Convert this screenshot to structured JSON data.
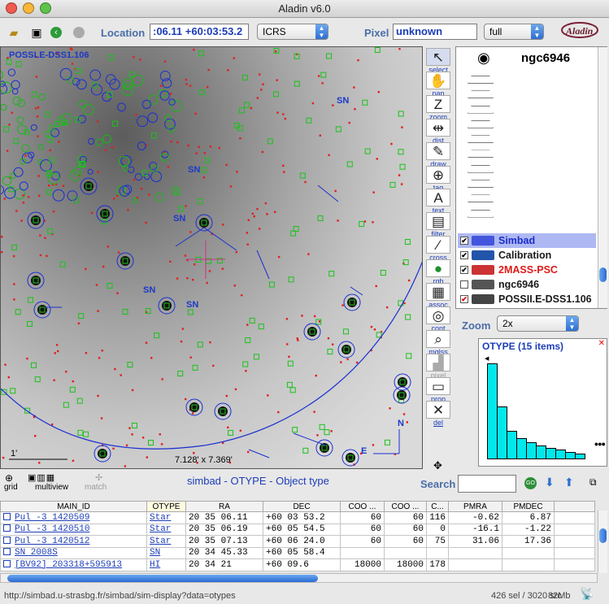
{
  "window": {
    "title": "Aladin v6.0"
  },
  "toolbar": {
    "location_label": "Location",
    "location_value": ":06.11 +60:03:53.2",
    "frame_value": "ICRS",
    "pixel_label": "Pixel",
    "pixel_value": "unknown",
    "scale_value": "full"
  },
  "view": {
    "survey_label": "POSSLE-DSS1.106",
    "scale_label": "1'",
    "fov_label": "7.128' x 7.369'",
    "compass_n": "N",
    "compass_e": "E",
    "sn_labels": [
      "SN",
      "SN",
      "SN",
      "SN",
      "SN"
    ]
  },
  "tools": [
    {
      "label": "select",
      "icon": "arrow-icon",
      "glyph": "↖"
    },
    {
      "label": "pan",
      "icon": "hand-icon",
      "glyph": "✋"
    },
    {
      "label": "zoom",
      "icon": "zoom-icon",
      "glyph": "Z"
    },
    {
      "label": "dist",
      "icon": "distance-icon",
      "glyph": "⇹"
    },
    {
      "label": "draw",
      "icon": "pencil-icon",
      "glyph": "✎"
    },
    {
      "label": "tag",
      "icon": "tag-icon",
      "glyph": "⊕"
    },
    {
      "label": "text",
      "icon": "text-icon",
      "glyph": "A"
    },
    {
      "label": "filter",
      "icon": "filter-icon",
      "glyph": "▤"
    },
    {
      "label": "cross",
      "icon": "crossmatch-icon",
      "glyph": "⁄"
    },
    {
      "label": "rgb",
      "icon": "rgb-icon",
      "glyph": "●"
    },
    {
      "label": "assoc",
      "icon": "film-icon",
      "glyph": "▦"
    },
    {
      "label": "cont",
      "icon": "contour-icon",
      "glyph": "◎"
    },
    {
      "label": "mglss",
      "icon": "magnifier-icon",
      "glyph": "⌕"
    },
    {
      "label": "pixel",
      "icon": "pixel-icon",
      "glyph": "▟"
    },
    {
      "label": "prop",
      "icon": "properties-icon",
      "glyph": "▭"
    },
    {
      "label": "del",
      "icon": "delete-icon",
      "glyph": "✕"
    }
  ],
  "stack": {
    "object_name": "ngc6946",
    "planes": [
      {
        "name": "Simbad",
        "color": "#1c2cc8",
        "checked": "✔",
        "icon_color": "#4455dd"
      },
      {
        "name": "Calibration",
        "color": "#1a1a1a",
        "checked": "✔",
        "icon_color": "#2255aa"
      },
      {
        "name": "2MASS-PSC",
        "color": "#e01818",
        "checked": "✔",
        "icon_color": "#cc3333"
      },
      {
        "name": "ngc6946",
        "color": "#1a1a1a",
        "checked": "",
        "icon_color": "#555555"
      },
      {
        "name": "POSSII.E-DSS1.106",
        "color": "#1a1a1a",
        "checked": "✔",
        "icon_color": "#444444"
      }
    ]
  },
  "zoom": {
    "label": "Zoom",
    "value": "2x"
  },
  "histogram": {
    "title": "OTYPE (15 items)",
    "close": "✕"
  },
  "chart_data": {
    "type": "bar",
    "title": "OTYPE (15 items)",
    "values": [
      100,
      55,
      30,
      22,
      18,
      14,
      12,
      10,
      8,
      6
    ]
  },
  "lower": {
    "grid_label": "grid",
    "multiview_label": "multiview",
    "match_label": "match",
    "table_title": "simbad - OTYPE - Object type",
    "search_label": "Search",
    "search_value": ""
  },
  "table": {
    "columns": [
      "MAIN_ID",
      "OTYPE",
      "RA",
      "DEC",
      "COO ...",
      "COO ...",
      "C...",
      "PMRA",
      "PMDEC",
      ""
    ],
    "rows": [
      [
        "Pul -3 1420509",
        "Star",
        "20 35 06.11",
        "+60 03 53.2",
        "60",
        "60",
        "116",
        "-0.62",
        "6.87"
      ],
      [
        "Pul -3 1420510",
        "Star",
        "20 35 06.19",
        "+60 05 54.5",
        "60",
        "60",
        "0",
        "-16.1",
        "-1.22"
      ],
      [
        "Pul -3 1420512",
        "Star",
        "20 35 07.13",
        "+60 06 24.0",
        "60",
        "60",
        "75",
        "31.06",
        "17.36"
      ],
      [
        "SN 2008S",
        "SN",
        "20 34 45.33",
        "+60 05 58.4",
        "",
        "",
        "",
        "",
        ""
      ],
      [
        "[BV92] 203318+595913",
        "HI",
        "20 34 21",
        "+60 09.6",
        "18000",
        "18000",
        "178",
        "",
        ""
      ]
    ]
  },
  "status": {
    "url": "http://simbad.u-strasbg.fr/simbad/sim-display?data=otypes",
    "count": "426 sel / 3020 src",
    "memory": "82Mb"
  }
}
